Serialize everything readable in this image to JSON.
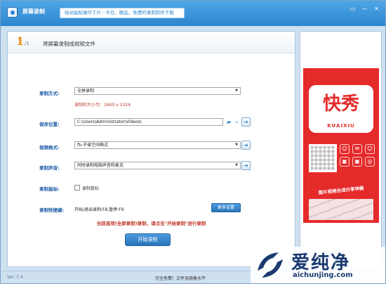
{
  "app": {
    "title": "屏幕录制",
    "banner": "轻动鼠标操作丁片 · 今日，精品，免费的录制软件下载",
    "window_buttons": [
      "▭",
      "—",
      "✕"
    ]
  },
  "step": {
    "number": "1",
    "sub": "/1",
    "title": "将屏幕录制成视频文件"
  },
  "form": {
    "mode_label": "录制方式:",
    "mode_value": "全屏录制",
    "size_note": "录制的大小为：1600 x 1024",
    "save_label": "保存位置:",
    "save_value": "C:\\Users\\Administrator\\Videos\\",
    "format_label": "视频格式:",
    "format_value": "fb-节省空间格式",
    "audio_label": "录制声音:",
    "audio_value": "同时录制电脑声音和麦克",
    "cursor_label": "录制鼠标:",
    "cursor_check_label": "录制鼠标",
    "hotkey_label": "录制快捷键:",
    "hotkey_value": "开始/退出录制:F8,暂停:F9",
    "more_settings": "更多设置"
  },
  "notice": "当前选项(全屏录制)录制，请点击\"开始录制\"进行录制",
  "start_button": "开始录制",
  "ad": {
    "logo_text": "快秀",
    "logo_sub": "KUAIXIU",
    "tagline": "图片视频合成分享神器",
    "icons": [
      "☺",
      "✉",
      "☺",
      "▣",
      "▣",
      "◎"
    ]
  },
  "status": {
    "version": "Ver. 7.4",
    "text": "完全免费！文件无随着水平"
  },
  "watermark": {
    "cn": "爱纯净",
    "url": "aichunjing.com"
  },
  "colors": {
    "titlebar": "#2d86cf",
    "accent_orange": "#f08a10",
    "label_blue": "#1a5aa5",
    "notice_red": "#c0392b",
    "ad_red": "#e52a2a"
  }
}
